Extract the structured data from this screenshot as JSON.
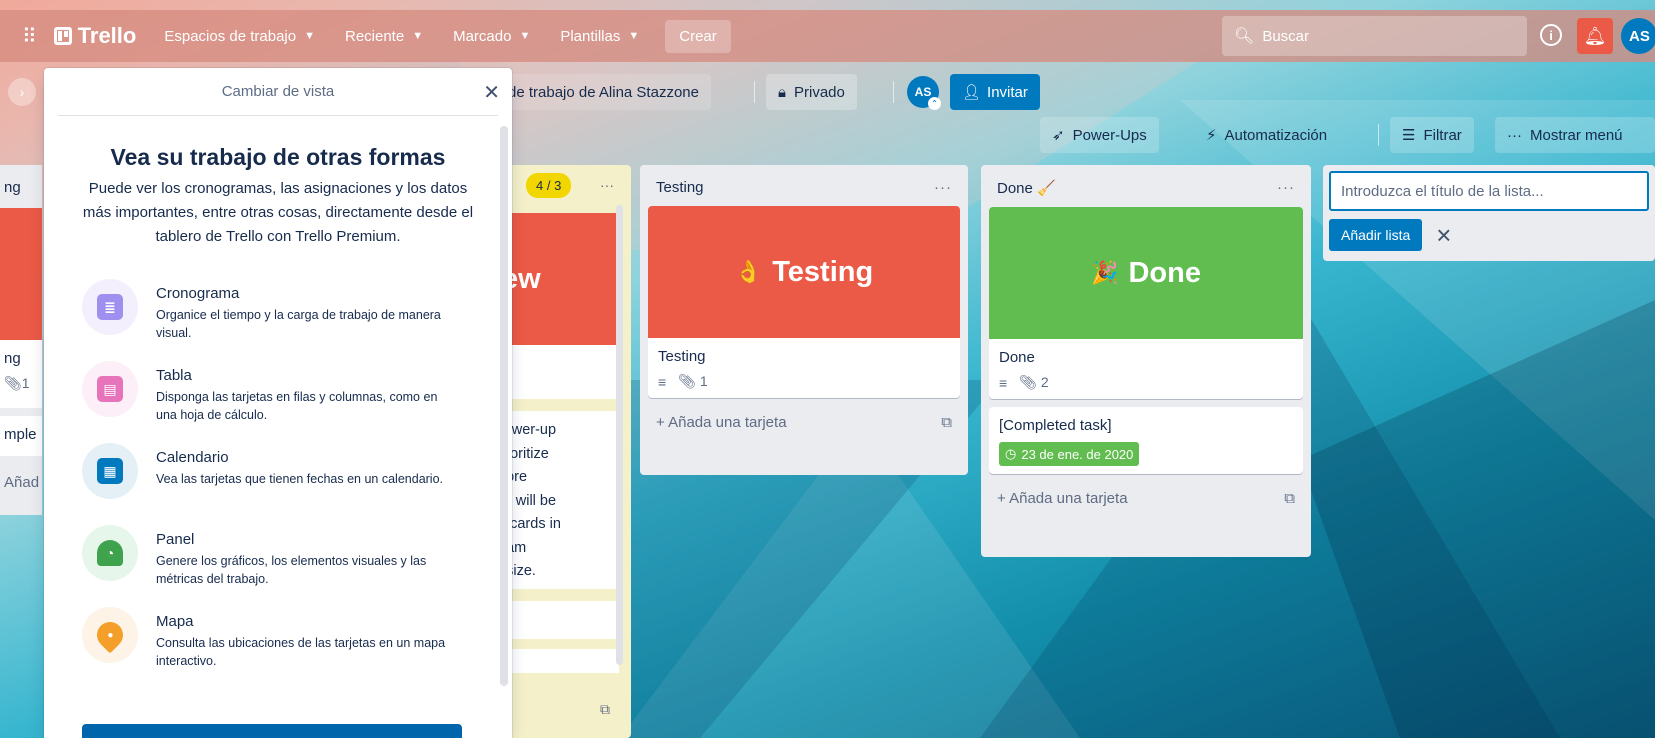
{
  "topbar": {
    "logo_text": "Trello",
    "workspaces": "Espacios de trabajo",
    "recent": "Reciente",
    "starred": "Marcado",
    "templates": "Plantillas",
    "create": "Crear",
    "search_label": "Buscar",
    "avatar": "AS"
  },
  "board_header": {
    "workspace": "de trabajo de Alina Stazzone",
    "visibility": "Privado",
    "avatar": "AS",
    "invite": "Invitar"
  },
  "board_menu": {
    "powerups": "Power-Ups",
    "automation": "Automatización",
    "filter": "Filtrar",
    "show_menu": "Mostrar menú"
  },
  "left_list": {
    "title": "ng",
    "card_title": "ng",
    "attachments": "1",
    "card2": "mple",
    "add": "Añad"
  },
  "mid_list": {
    "count": "4 / 3",
    "cover_text": "ew",
    "card_text": [
      "Power-up",
      "prioritize",
      "efore",
      "list will be",
      "of cards in",
      "team",
      "n size."
    ]
  },
  "lists": [
    {
      "title": "Testing",
      "cover_label": "Testing",
      "cover_emoji": "👌",
      "cover_color": "#eb5a46",
      "card_title": "Testing",
      "attachments": "1",
      "add_card": "Añada una tarjeta"
    },
    {
      "title": "Done 🧹",
      "cover_label": "Done",
      "cover_emoji": "🎉",
      "cover_color": "#61bd4f",
      "card_title": "Done",
      "attachments": "2",
      "card2_title": "[Completed task]",
      "card2_due": "23 de ene. de 2020",
      "add_card": "Añada una tarjeta"
    }
  ],
  "composer": {
    "placeholder": "Introduzca el título de la lista...",
    "add_button": "Añadir lista"
  },
  "panel": {
    "header": "Cambiar de vista",
    "title": "Vea su trabajo de otras formas",
    "description": "Puede ver los cronogramas, las asignaciones y los datos más importantes, entre otras cosas, directamente desde el tablero de Trello con Trello Premium.",
    "features": [
      {
        "name": "Cronograma",
        "desc": "Organice el tiempo y la carga de trabajo de manera visual.",
        "icon": "timeline-icon",
        "color": "#9f8fef",
        "bg": "#f3effd"
      },
      {
        "name": "Tabla",
        "desc": "Disponga las tarjetas en filas y columnas, como en una hoja de cálculo.",
        "icon": "table-icon",
        "color": "#e774bb",
        "bg": "#fdeff7"
      },
      {
        "name": "Calendario",
        "desc": "Vea las tarjetas que tienen fechas en un calendario.",
        "icon": "calendar-icon",
        "color": "#0079bf",
        "bg": "#e4f0f6"
      },
      {
        "name": "Panel",
        "desc": "Genere los gráficos, los elementos visuales y las métricas del trabajo.",
        "icon": "dashboard-icon",
        "color": "#3fa34d",
        "bg": "#e6f6ea"
      },
      {
        "name": "Mapa",
        "desc": "Consulta las ubicaciones de las tarjetas en un mapa interactivo.",
        "icon": "map-pin-icon",
        "color": "#f59f2b",
        "bg": "#fdf3e6"
      }
    ]
  }
}
